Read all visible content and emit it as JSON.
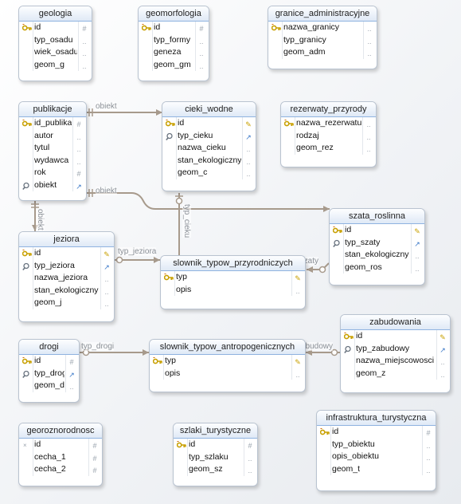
{
  "entities": {
    "geologia": {
      "title": "geologia",
      "columns": [
        {
          "name": "id",
          "key": "pk",
          "mark": "#"
        },
        {
          "name": "typ_osadu",
          "key": "",
          "mark": ".."
        },
        {
          "name": "wiek_osadu",
          "key": "",
          "mark": ".."
        },
        {
          "name": "geom_g",
          "key": "",
          "mark": ".."
        }
      ]
    },
    "geomorfologia": {
      "title": "geomorfologia",
      "columns": [
        {
          "name": "id",
          "key": "pk",
          "mark": "#"
        },
        {
          "name": "typ_formy",
          "key": "",
          "mark": ".."
        },
        {
          "name": "geneza",
          "key": "",
          "mark": ".."
        },
        {
          "name": "geom_gm",
          "key": "",
          "mark": ".."
        }
      ]
    },
    "granice": {
      "title": "granice_administracyjne",
      "columns": [
        {
          "name": "nazwa_granicy",
          "key": "pk",
          "mark": ".."
        },
        {
          "name": "typ_granicy",
          "key": "",
          "mark": ".."
        },
        {
          "name": "geom_adm",
          "key": "",
          "mark": ".."
        }
      ]
    },
    "publikacje": {
      "title": "publikacje",
      "columns": [
        {
          "name": "id_publikacji",
          "key": "pk",
          "mark": "#"
        },
        {
          "name": "autor",
          "key": "",
          "mark": ".."
        },
        {
          "name": "tytul",
          "key": "",
          "mark": ".."
        },
        {
          "name": "wydawca",
          "key": "",
          "mark": ".."
        },
        {
          "name": "rok",
          "key": "",
          "mark": "#"
        },
        {
          "name": "obiekt",
          "key": "fk",
          "mark": "↗"
        }
      ]
    },
    "cieki": {
      "title": "cieki_wodne",
      "columns": [
        {
          "name": "id",
          "key": "pk",
          "mark": "✎"
        },
        {
          "name": "typ_cieku",
          "key": "fk",
          "mark": "↗"
        },
        {
          "name": "nazwa_cieku",
          "key": "",
          "mark": ".."
        },
        {
          "name": "stan_ekologiczny",
          "key": "",
          "mark": ".."
        },
        {
          "name": "geom_c",
          "key": "",
          "mark": ".."
        }
      ]
    },
    "rezerwaty": {
      "title": "rezerwaty_przyrody",
      "columns": [
        {
          "name": "nazwa_rezerwatu",
          "key": "pk",
          "mark": ".."
        },
        {
          "name": "rodzaj",
          "key": "",
          "mark": ".."
        },
        {
          "name": "geom_rez",
          "key": "",
          "mark": ".."
        }
      ]
    },
    "szata": {
      "title": "szata_roslinna",
      "columns": [
        {
          "name": "id",
          "key": "pk",
          "mark": "✎"
        },
        {
          "name": "typ_szaty",
          "key": "fk",
          "mark": "↗"
        },
        {
          "name": "stan_ekologiczny",
          "key": "",
          "mark": ".."
        },
        {
          "name": "geom_ros",
          "key": "",
          "mark": ".."
        }
      ]
    },
    "jeziora": {
      "title": "jeziora",
      "columns": [
        {
          "name": "id",
          "key": "pk",
          "mark": "✎"
        },
        {
          "name": "typ_jeziora",
          "key": "fk",
          "mark": "↗"
        },
        {
          "name": "nazwa_jeziora",
          "key": "",
          "mark": ".."
        },
        {
          "name": "stan_ekologiczny",
          "key": "",
          "mark": ".."
        },
        {
          "name": "geom_j",
          "key": "",
          "mark": ".."
        }
      ]
    },
    "slownik_p": {
      "title": "slownik_typow_przyrodniczych",
      "columns": [
        {
          "name": "typ",
          "key": "pk",
          "mark": "✎"
        },
        {
          "name": "opis",
          "key": "",
          "mark": ".."
        }
      ]
    },
    "drogi": {
      "title": "drogi",
      "columns": [
        {
          "name": "id",
          "key": "pk",
          "mark": "#"
        },
        {
          "name": "typ_drogi",
          "key": "fk",
          "mark": "↗"
        },
        {
          "name": "geom_d",
          "key": "",
          "mark": ".."
        }
      ]
    },
    "slownik_a": {
      "title": "slownik_typow_antropogenicznych",
      "columns": [
        {
          "name": "typ",
          "key": "pk",
          "mark": "✎"
        },
        {
          "name": "opis",
          "key": "",
          "mark": ".."
        }
      ]
    },
    "zabudowania": {
      "title": "zabudowania",
      "columns": [
        {
          "name": "id",
          "key": "pk",
          "mark": "✎"
        },
        {
          "name": "typ_zabudowy",
          "key": "fk",
          "mark": "↗"
        },
        {
          "name": "nazwa_miejscowosci",
          "key": "",
          "mark": ".."
        },
        {
          "name": "geom_z",
          "key": "",
          "mark": ".."
        }
      ]
    },
    "georoznorodnosc": {
      "title": "georoznorodnosc",
      "columns": [
        {
          "name": "id",
          "key": "none",
          "mark": "#"
        },
        {
          "name": "cecha_1",
          "key": "",
          "mark": "#"
        },
        {
          "name": "cecha_2",
          "key": "",
          "mark": "#"
        }
      ]
    },
    "szlaki": {
      "title": "szlaki_turystyczne",
      "columns": [
        {
          "name": "id",
          "key": "pk",
          "mark": "#"
        },
        {
          "name": "typ_szlaku",
          "key": "",
          "mark": ".."
        },
        {
          "name": "geom_sz",
          "key": "",
          "mark": ".."
        }
      ]
    },
    "infrastruktura": {
      "title": "infrastruktura_turystyczna",
      "columns": [
        {
          "name": "id",
          "key": "pk",
          "mark": "#"
        },
        {
          "name": "typ_obiektu",
          "key": "",
          "mark": ".."
        },
        {
          "name": "opis_obiektu",
          "key": "",
          "mark": ".."
        },
        {
          "name": "geom_t",
          "key": "",
          "mark": ".."
        }
      ]
    }
  },
  "relations": [
    {
      "label": "obiekt",
      "from": "publikacje",
      "to": "cieki"
    },
    {
      "label": "obiekt",
      "from": "publikacje",
      "to": "szata"
    },
    {
      "label": "obiekt",
      "from": "publikacje",
      "to": "jeziora"
    },
    {
      "label": "typ_cieku",
      "from": "cieki",
      "to": "slownik_p"
    },
    {
      "label": "typ_jeziora",
      "from": "jeziora",
      "to": "slownik_p"
    },
    {
      "label": "typ_szaty",
      "from": "szata",
      "to": "slownik_p"
    },
    {
      "label": "typ_drogi",
      "from": "drogi",
      "to": "slownik_a"
    },
    {
      "label": "typ_zabudowy",
      "from": "zabudowania",
      "to": "slownik_a"
    }
  ]
}
